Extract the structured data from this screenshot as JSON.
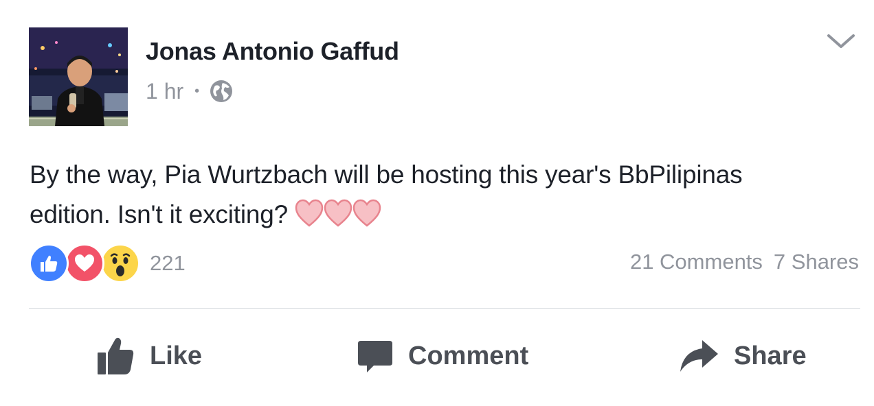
{
  "post": {
    "author": "Jonas Antonio Gaffud",
    "time": "1 hr",
    "separator": "•",
    "privacy_icon": "globe-icon",
    "text_line1": "By the way, Pia Wurtzbach will be hosting this year's BbPilipinas",
    "text_line2": "edition. Isn't it exciting?",
    "inline_emoji": "pink-heart-icons"
  },
  "reactions": {
    "icons": [
      "like-reaction-icon",
      "love-reaction-icon",
      "wow-reaction-icon"
    ],
    "count": "221"
  },
  "counts": {
    "comments": "21 Comments",
    "shares": "7 Shares"
  },
  "actions": {
    "like": "Like",
    "comment": "Comment",
    "share": "Share"
  },
  "colors": {
    "like_blue": "#4080ff",
    "love_red": "#f25268",
    "wow_yellow": "#fcd54a",
    "secondary_text": "#90949c",
    "action_text": "#4b4f56"
  }
}
